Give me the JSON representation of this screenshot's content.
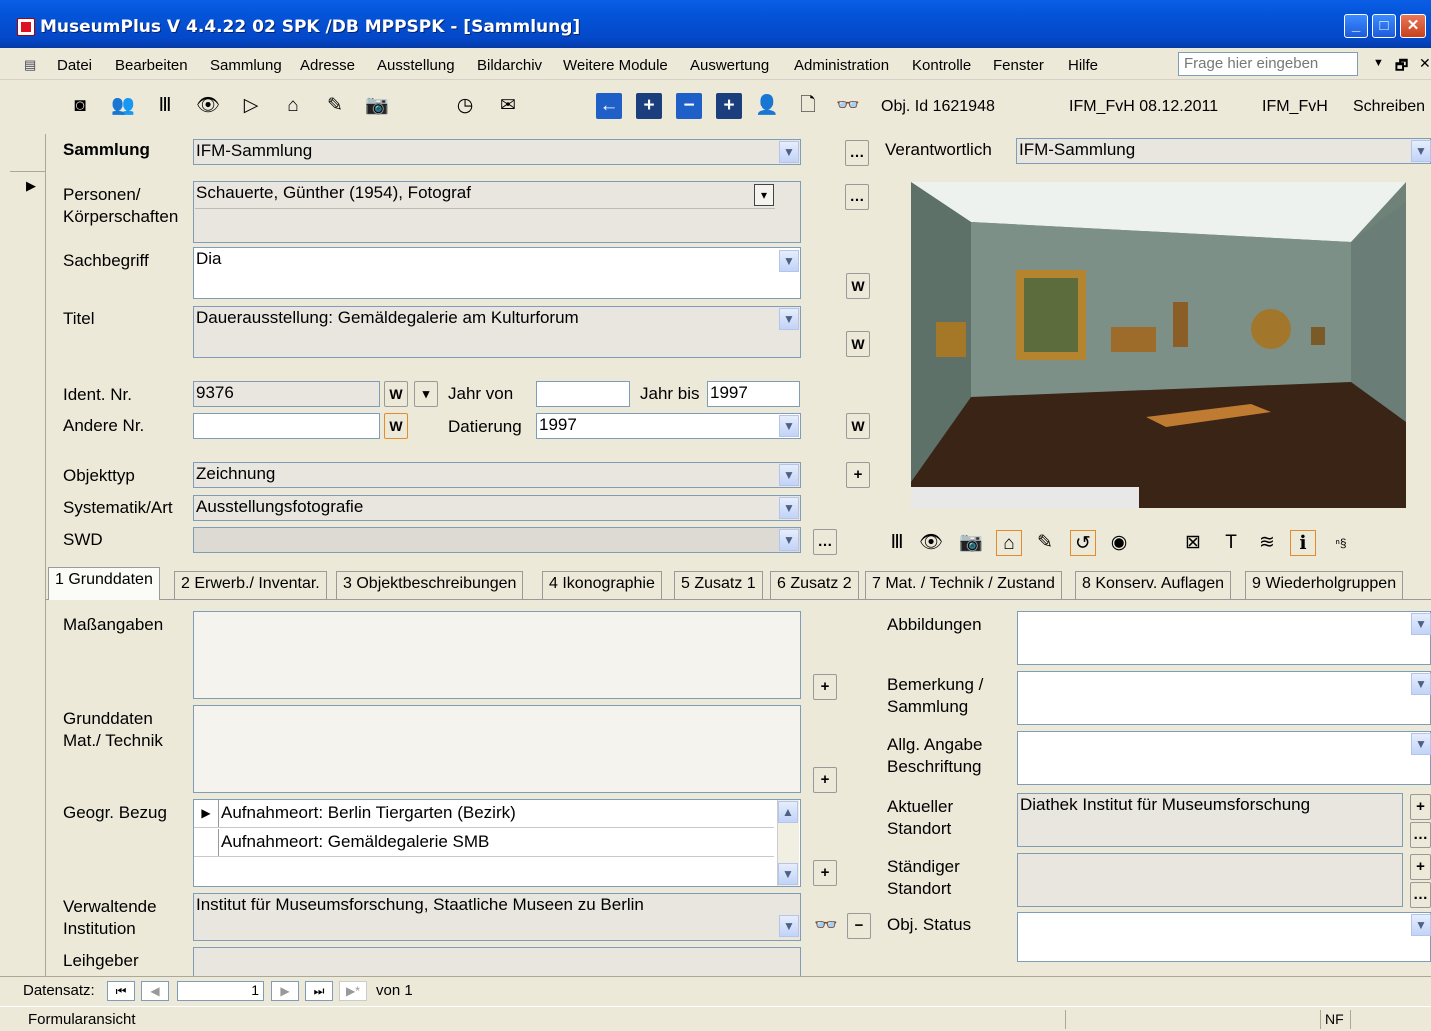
{
  "window": {
    "title": "MuseumPlus V 4.4.22 02 SPK /DB MPPSPK - [Sammlung]"
  },
  "menu": [
    "Datei",
    "Bearbeiten",
    "Sammlung",
    "Adresse",
    "Ausstellung",
    "Bildarchiv",
    "Weitere Module",
    "Auswertung",
    "Administration",
    "Kontrolle",
    "Fenster",
    "Hilfe"
  ],
  "help_placeholder": "Frage hier eingeben",
  "info": {
    "obj_id": "Obj. Id  1621948",
    "user_date": "IFM_FvH 08.12.2011",
    "user": "IFM_FvH",
    "mode": "Schreiben"
  },
  "form": {
    "sammlung_label": "Sammlung",
    "sammlung_value": "IFM-Sammlung",
    "verantwortlich_label": "Verantwortlich",
    "verantwortlich_value": "IFM-Sammlung",
    "personen_label1": "Personen/",
    "personen_label2": "Körperschaften",
    "personen_value": "Schauerte, Günther (1954), Fotograf",
    "sachbegriff_label": "Sachbegriff",
    "sachbegriff_value": "Dia",
    "titel_label": "Titel",
    "titel_value": "Dauerausstellung: Gemäldegalerie am Kulturforum",
    "ident_label": "Ident. Nr.",
    "ident_value": "9376",
    "jahr_von_label": "Jahr von",
    "jahr_von_value": "",
    "jahr_bis_label": "Jahr bis",
    "jahr_bis_value": "1997",
    "andere_label": "Andere Nr.",
    "andere_value": "",
    "datierung_label": "Datierung",
    "datierung_value": "1997",
    "objekttyp_label": "Objekttyp",
    "objekttyp_value": "Zeichnung",
    "systematik_label": "Systematik/Art",
    "systematik_value": "Ausstellungsfotografie",
    "swd_label": "SWD",
    "swd_value": "",
    "w": "W"
  },
  "tabs": [
    "1 Grunddaten",
    "2 Erwerb./ Inventar.",
    "3 Objektbeschreibungen",
    "4 Ikonographie",
    "5 Zusatz 1",
    "6 Zusatz 2",
    "7 Mat. / Technik / Zustand",
    "8 Konserv. Auflagen",
    "9 Wiederholgruppen"
  ],
  "grund": {
    "mass_label": "Maßangaben",
    "gmt_label1": "Grunddaten",
    "gmt_label2": "Mat./ Technik",
    "geogr_label": "Geogr. Bezug",
    "geogr_rows": [
      "Aufnahmeort: Berlin Tiergarten (Bezirk)",
      "Aufnahmeort: Gemäldegalerie SMB"
    ],
    "verw_label1": "Verwaltende",
    "verw_label2": "Institution",
    "verw_value": "Institut für Museumsforschung, Staatliche Museen zu Berlin",
    "leih_label": "Leihgeber",
    "abb_label": "Abbildungen",
    "bem_label1": "Bemerkung /",
    "bem_label2": "Sammlung",
    "allg_label1": "Allg. Angabe",
    "allg_label2": "Beschriftung",
    "akt_label1": "Aktueller",
    "akt_label2": "Standort",
    "akt_value": "Diathek Institut für Museumsforschung",
    "staend_label1": "Ständiger",
    "staend_label2": "Standort",
    "status_label": "Obj. Status"
  },
  "nav": {
    "label": "Datensatz:",
    "record": "1",
    "of": "von 1"
  },
  "status": {
    "view": "Formularansicht",
    "nf": "NF"
  }
}
